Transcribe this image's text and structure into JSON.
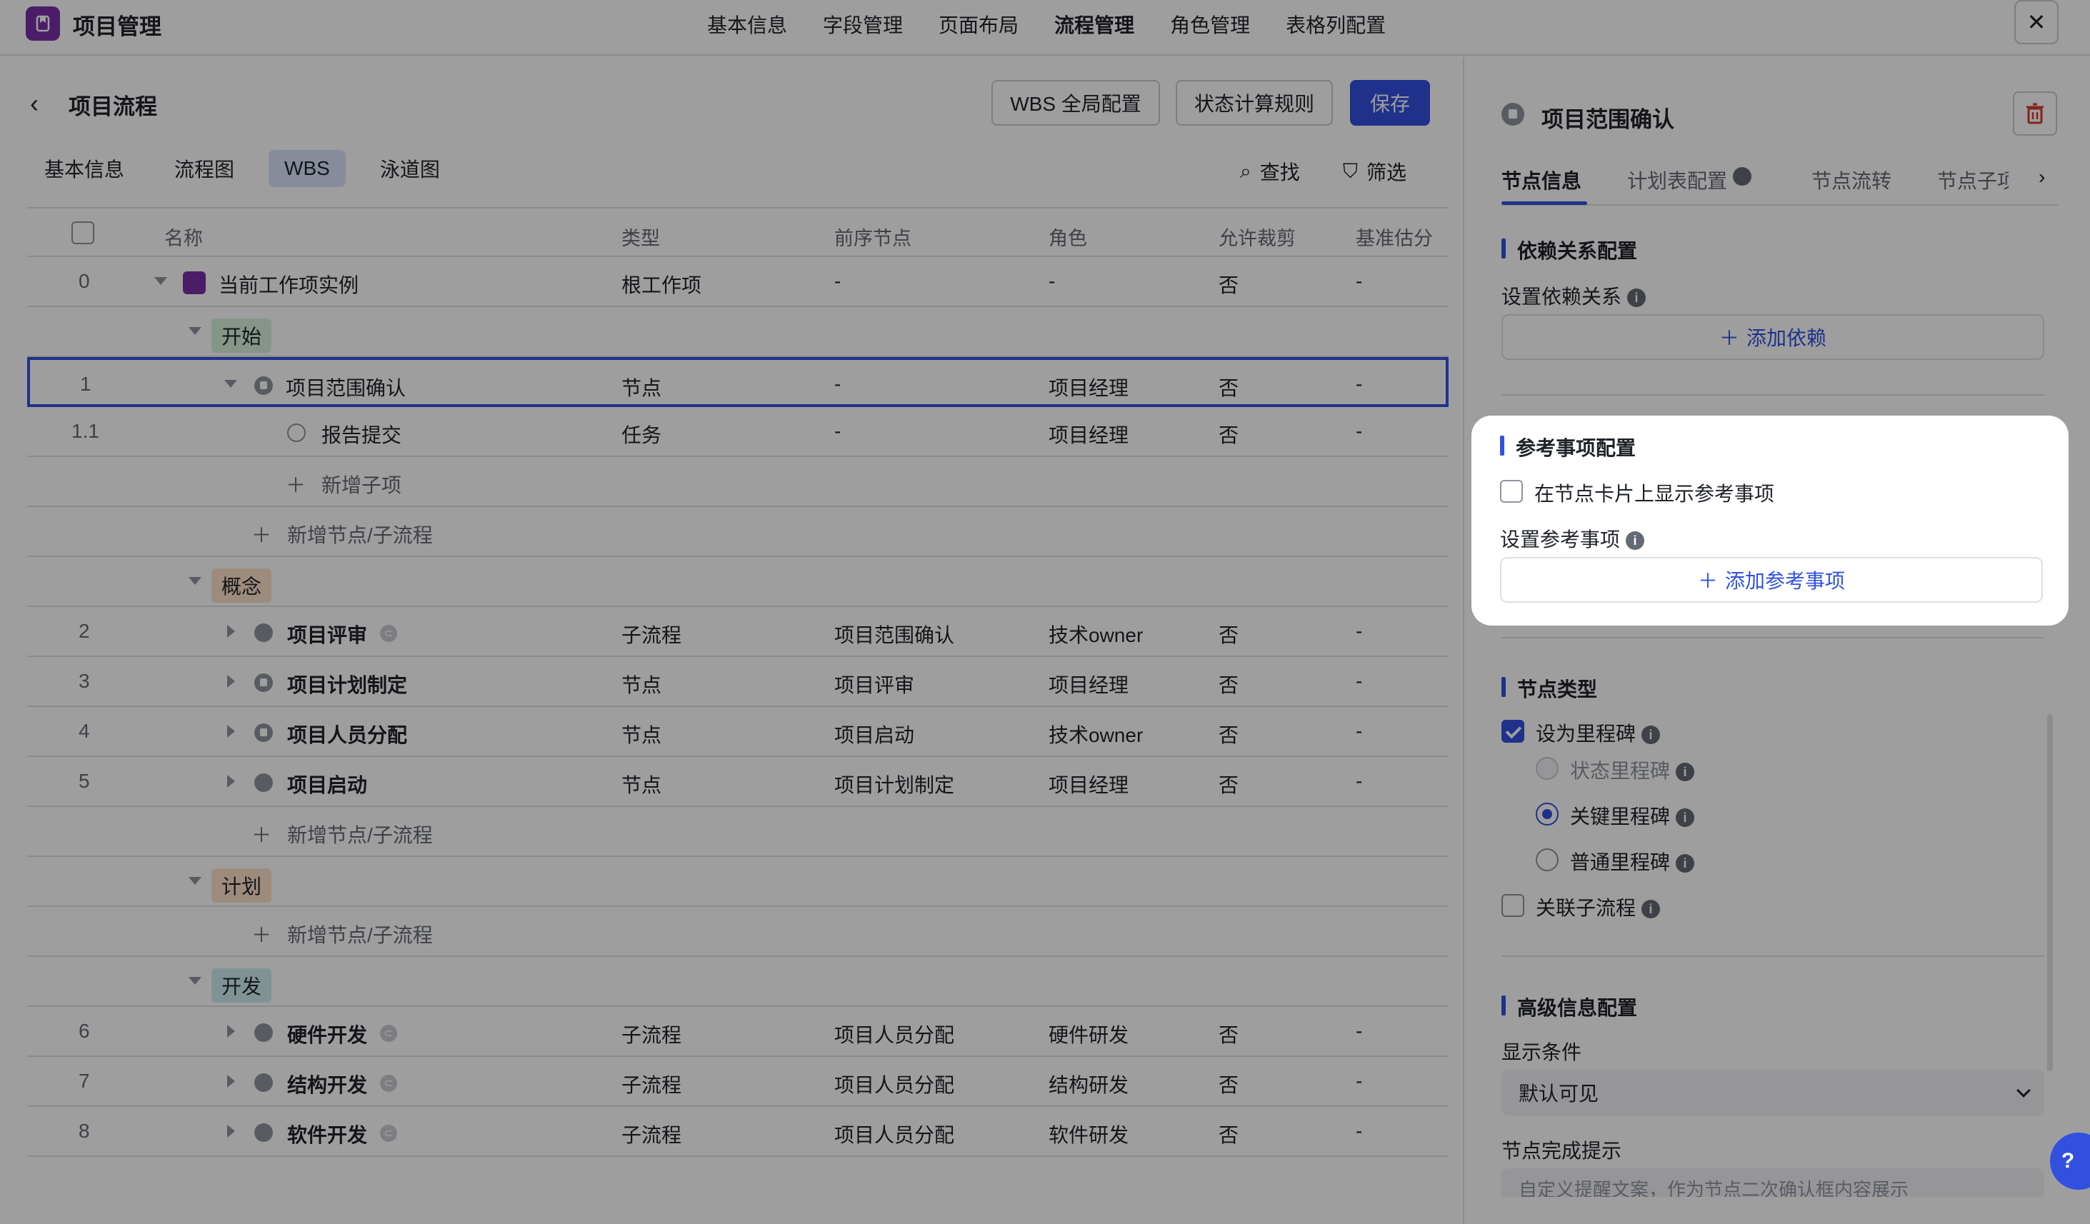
{
  "app": {
    "title": "项目管理"
  },
  "topnav": {
    "tabs": [
      "基本信息",
      "字段管理",
      "页面布局",
      "流程管理",
      "角色管理",
      "表格列配置"
    ],
    "active": "流程管理"
  },
  "page": {
    "title": "项目流程",
    "buttons": {
      "wbs_config": "WBS 全局配置",
      "status_rule": "状态计算规则",
      "save": "保存"
    },
    "subtabs": [
      "基本信息",
      "流程图",
      "WBS",
      "泳道图"
    ],
    "tools": {
      "find": "查找",
      "filter": "筛选"
    }
  },
  "table": {
    "headers": [
      "名称",
      "类型",
      "前序节点",
      "角色",
      "允许裁剪",
      "基准估分"
    ],
    "rows": [
      {
        "idx": "0",
        "name": "当前工作项实例",
        "type": "根工作项",
        "prev": "-",
        "role": "-",
        "cut": "否",
        "est": "-"
      },
      {
        "phase": "开始"
      },
      {
        "idx": "1",
        "name": "项目范围确认",
        "type": "节点",
        "prev": "-",
        "role": "项目经理",
        "cut": "否",
        "est": "-"
      },
      {
        "idx": "1.1",
        "name": "报告提交",
        "type": "任务",
        "prev": "-",
        "role": "项目经理",
        "cut": "否",
        "est": "-"
      },
      {
        "add": "新增子项"
      },
      {
        "add": "新增节点/子流程"
      },
      {
        "phase": "概念"
      },
      {
        "idx": "2",
        "name": "项目评审",
        "type": "子流程",
        "prev": "项目范围确认",
        "role": "技术owner",
        "cut": "否",
        "est": "-"
      },
      {
        "idx": "3",
        "name": "项目计划制定",
        "type": "节点",
        "prev": "项目评审",
        "role": "项目经理",
        "cut": "否",
        "est": "-"
      },
      {
        "idx": "4",
        "name": "项目人员分配",
        "type": "节点",
        "prev": "项目启动",
        "role": "技术owner",
        "cut": "否",
        "est": "-"
      },
      {
        "idx": "5",
        "name": "项目启动",
        "type": "节点",
        "prev": "项目计划制定",
        "role": "项目经理",
        "cut": "否",
        "est": "-"
      },
      {
        "add": "新增节点/子流程"
      },
      {
        "phase": "计划"
      },
      {
        "add": "新增节点/子流程"
      },
      {
        "phase": "开发"
      },
      {
        "idx": "6",
        "name": "硬件开发",
        "type": "子流程",
        "prev": "项目人员分配",
        "role": "硬件研发",
        "cut": "否",
        "est": "-"
      },
      {
        "idx": "7",
        "name": "结构开发",
        "type": "子流程",
        "prev": "项目人员分配",
        "role": "结构研发",
        "cut": "否",
        "est": "-"
      },
      {
        "idx": "8",
        "name": "软件开发",
        "type": "子流程",
        "prev": "项目人员分配",
        "role": "软件研发",
        "cut": "否",
        "est": "-"
      }
    ]
  },
  "drawer": {
    "title": "项目范围确认",
    "tabs": [
      "节点信息",
      "计划表配置",
      "节点流转",
      "节点子项"
    ],
    "tab_visible": [
      "节点信息",
      "计划表配置",
      "节点流转",
      "节点子项"
    ],
    "dependency": {
      "title": "依赖关系配置",
      "label": "设置依赖关系",
      "add": "添加依赖"
    },
    "reference": {
      "title": "参考事项配置",
      "show_on_card": "在节点卡片上显示参考事项",
      "label": "设置参考事项",
      "add": "添加参考事项"
    },
    "node_type": {
      "title": "节点类型",
      "milestone": "设为里程碑",
      "options": [
        "状态里程碑",
        "关键里程碑",
        "普通里程碑"
      ],
      "link_subflow": "关联子流程"
    },
    "advanced": {
      "title": "高级信息配置",
      "display_condition_label": "显示条件",
      "display_condition_value": "默认可见",
      "complete_hint_label": "节点完成提示",
      "complete_hint_placeholder": "自定义提醒文案，作为节点二次确认框内容展示"
    }
  }
}
